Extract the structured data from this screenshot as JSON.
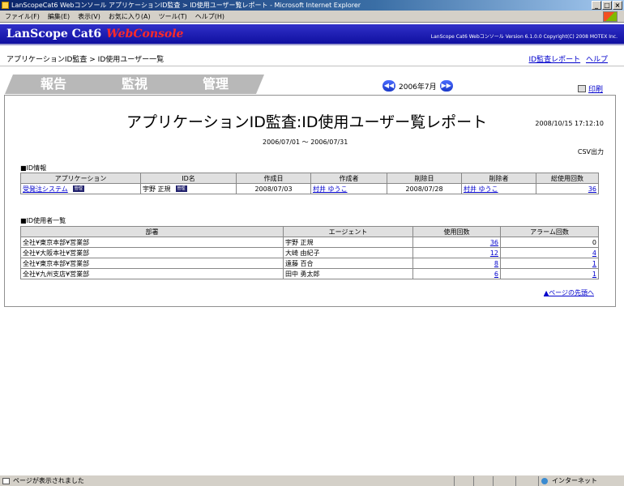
{
  "window": {
    "title": "LanScopeCat6 Webコンソール アプリケーションID監査 > ID使用ユーザー覧レポート - Microsoft Internet Explorer",
    "minimize": "_",
    "maximize": "□",
    "close": "×"
  },
  "menu": [
    "ファイル(F)",
    "編集(E)",
    "表示(V)",
    "お気に入り(A)",
    "ツール(T)",
    "ヘルプ(H)"
  ],
  "header": {
    "brand": "LanScope Cat6",
    "brand_accent": "WebConsole",
    "version": "LanScope Cat6 Webコンソール Version 6.1.0.0 Copyright(C) 2008 MOTEX Inc."
  },
  "breadcrumb": "アプリケーションID監査 > ID使用ユーザー一覧",
  "toplinks": {
    "report": "ID監査レポート",
    "help": "ヘルプ"
  },
  "tabs": [
    "報告",
    "監視",
    "管理"
  ],
  "month_nav": {
    "prev": "◀◀",
    "label": "2006年7月",
    "next": "▶▶"
  },
  "print_label": "印刷",
  "report": {
    "title": "アプリケーションID監査:ID使用ユーザー覧レポート",
    "generated": "2008/10/15 17:12:10",
    "range": "2006/07/01 〜 2006/07/31",
    "csv": "CSV出力"
  },
  "id_info": {
    "section": "■ID情報",
    "headers": [
      "アプリケーション",
      "ID名",
      "作成日",
      "作成者",
      "削除日",
      "削除者",
      "総使用回数"
    ],
    "row": {
      "app": "受発注システム",
      "app_badge": "管理",
      "id_name": "宇野 正規",
      "id_badge": "管理",
      "created": "2008/07/03",
      "creator": "村井 ゆうこ",
      "deleted": "2008/07/28",
      "deleter": "村井 ゆうこ",
      "total": "36"
    }
  },
  "users": {
    "section": "■ID使用者一覧",
    "headers": [
      "部署",
      "エージェント",
      "使用回数",
      "アラーム回数"
    ],
    "rows": [
      {
        "dept": "全社¥東京本部¥営業部",
        "agent": "宇野 正規",
        "uses": "36",
        "alarms": "0"
      },
      {
        "dept": "全社¥大阪本社¥営業部",
        "agent": "大崎 由紀子",
        "uses": "12",
        "alarms": "4"
      },
      {
        "dept": "全社¥東京本部¥営業部",
        "agent": "遠藤 百合",
        "uses": "8",
        "alarms": "1"
      },
      {
        "dept": "全社¥九州支店¥営業部",
        "agent": "田中 勇太郎",
        "uses": "6",
        "alarms": "1"
      }
    ]
  },
  "to_top": "▲ページの先頭へ",
  "status": {
    "text": "ページが表示されました",
    "zone": "インターネット"
  }
}
